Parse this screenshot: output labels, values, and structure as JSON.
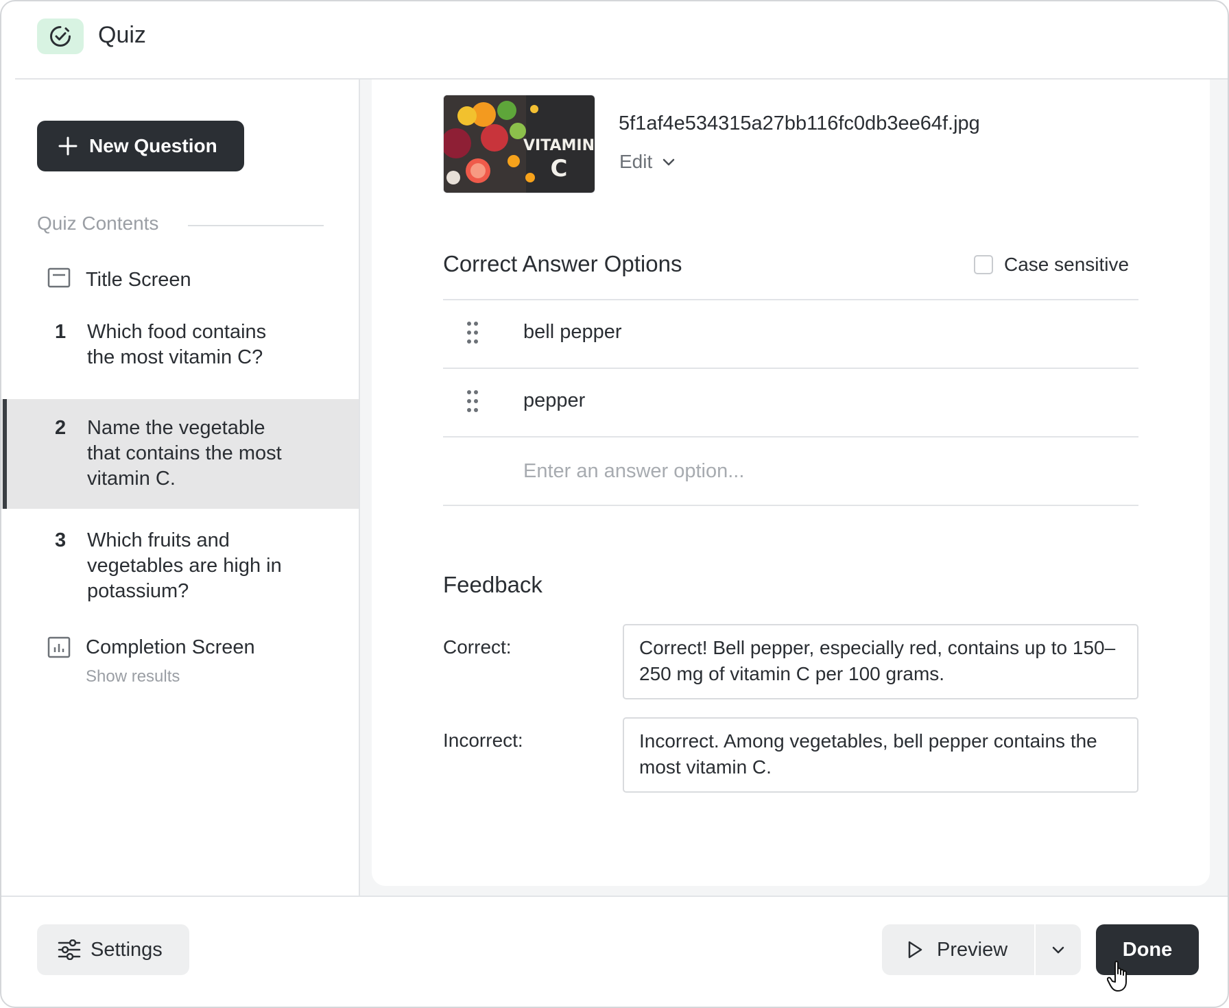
{
  "header": {
    "title": "Quiz",
    "icon": "check-circle-icon",
    "badge_color": "#d8f3e2"
  },
  "sidebar": {
    "new_question_label": "New Question",
    "section_label": "Quiz Contents",
    "title_screen_label": "Title Screen",
    "questions": [
      {
        "num": "1",
        "text": "Which food contains the most vitamin C?"
      },
      {
        "num": "2",
        "text": "Name the vegetable that contains the most vitamin C."
      },
      {
        "num": "3",
        "text": "Which fruits and vegetables are high in potassium?"
      }
    ],
    "active_question_index": 1,
    "completion_label": "Completion Screen",
    "completion_sub": "Show results"
  },
  "media": {
    "file_name": "5f1af4e534315a27bb116fc0db3ee64f.jpg",
    "edit_label": "Edit",
    "thumb_text_1": "VITAMIN",
    "thumb_text_2": "C"
  },
  "answers": {
    "heading": "Correct Answer Options",
    "case_sensitive_label": "Case sensitive",
    "case_sensitive_checked": false,
    "options": [
      "bell pepper",
      "pepper"
    ],
    "placeholder": "Enter an answer option..."
  },
  "feedback": {
    "heading": "Feedback",
    "correct_label": "Correct:",
    "correct_text": "Correct! Bell pepper, especially red, contains up to 150–250 mg of vitamin C per 100 grams.",
    "incorrect_label": "Incorrect:",
    "incorrect_text": "Incorrect. Among vegetables, bell pepper contains the most vitamin C."
  },
  "footer": {
    "settings_label": "Settings",
    "preview_label": "Preview",
    "done_label": "Done"
  }
}
